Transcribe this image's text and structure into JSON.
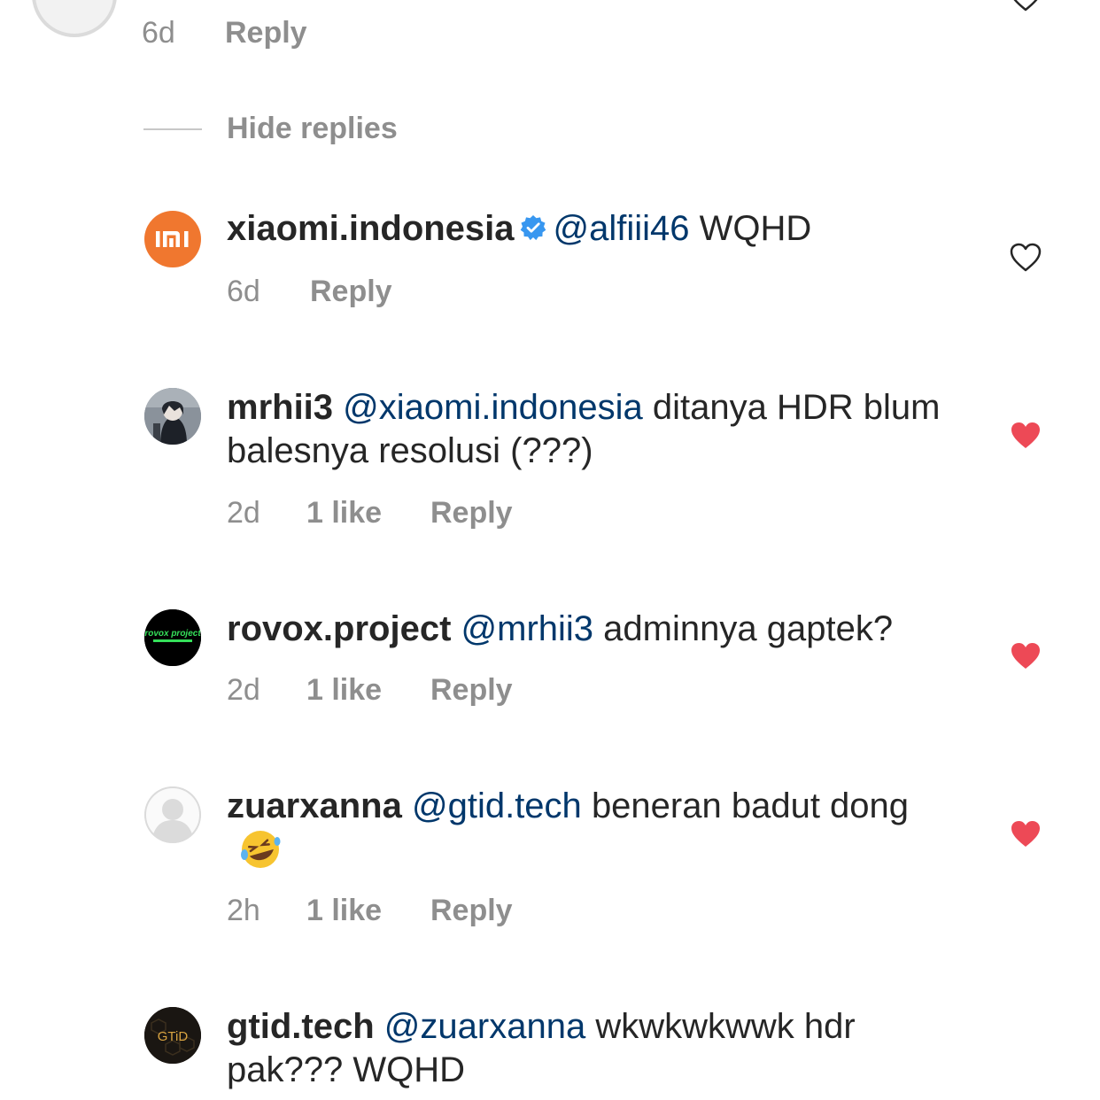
{
  "top_comment": {
    "time": "6d",
    "reply_label": "Reply"
  },
  "hide_replies_label": "Hide replies",
  "replies": [
    {
      "username": "xiaomi.indonesia",
      "verified": true,
      "mention": "@alfiii46",
      "text": "WQHD",
      "time": "6d",
      "likes": "",
      "reply_label": "Reply",
      "liked": false,
      "avatar": "xiaomi-mi-logo"
    },
    {
      "username": "mrhii3",
      "verified": false,
      "mention": "@xiaomi.indonesia",
      "text": "ditanya HDR blum balesnya resolusi (???)",
      "time": "2d",
      "likes": "1 like",
      "reply_label": "Reply",
      "liked": true,
      "avatar": "anime-character-photo"
    },
    {
      "username": "rovox.project",
      "verified": false,
      "mention": "@mrhii3",
      "text": "adminnya gaptek?",
      "time": "2d",
      "likes": "1 like",
      "reply_label": "Reply",
      "liked": true,
      "avatar": "rovox-project-logo",
      "avatar_text": "rovox project"
    },
    {
      "username": "zuarxanna",
      "verified": false,
      "mention": "@gtid.tech",
      "text": "beneran badut dong",
      "emoji": "rolling-on-floor-laughing-emoji",
      "time": "2h",
      "likes": "1 like",
      "reply_label": "Reply",
      "liked": true,
      "avatar": "default-avatar"
    },
    {
      "username": "gtid.tech",
      "verified": false,
      "mention": "@zuarxanna",
      "text": "wkwkwkwwk hdr pak??? WQHD",
      "liked": false,
      "avatar": "gtid-logo",
      "avatar_text": "GTiD"
    }
  ],
  "colors": {
    "mention": "#00376b",
    "heart_filled": "#ed4956",
    "meta_gray": "#8e8e8e",
    "xiaomi_orange": "#f0772f"
  }
}
